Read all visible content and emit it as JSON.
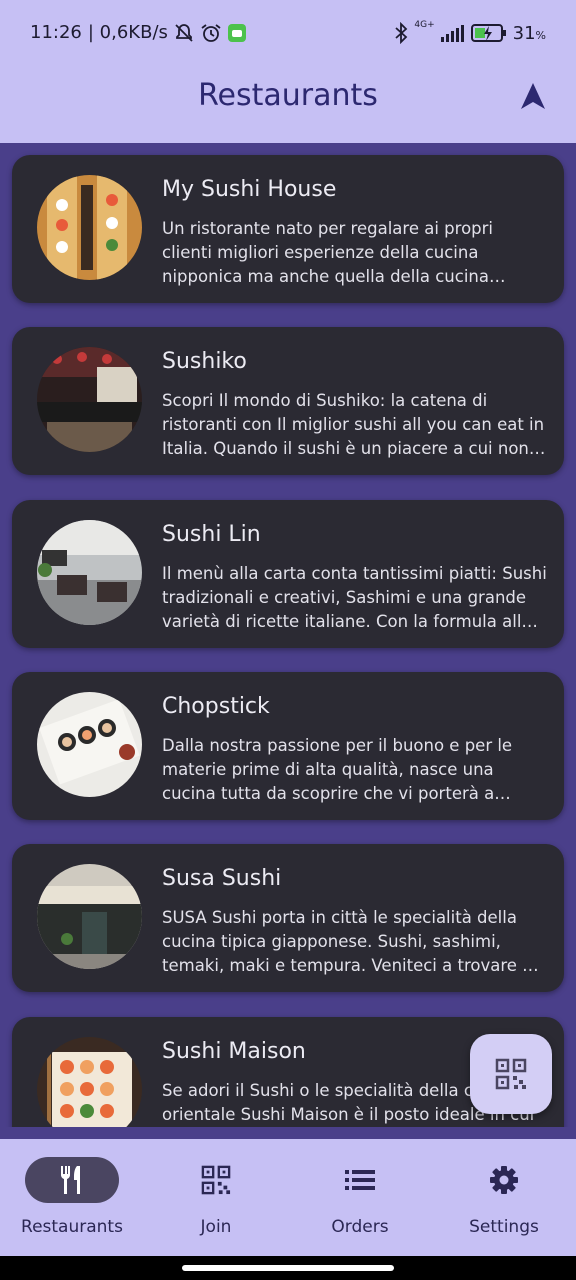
{
  "status_bar": {
    "time": "11:26",
    "network_speed": "| 0,6KB/s",
    "signal_label": "4G+",
    "battery_percent": "31",
    "battery_unit": "%"
  },
  "app_bar": {
    "title": "Restaurants",
    "navigation_icon": "navigation-arrow-icon"
  },
  "restaurants": [
    {
      "name": "My Sushi House",
      "description": "Un ristorante nato per regalare  ai propri clienti migliori esperienze della cucina nipponica ma anche quella della cucina cinese.",
      "image": "sushi-boats-photo"
    },
    {
      "name": "Sushiko",
      "description": "Scopri Il mondo di Sushiko: la catena di ristoranti con Il miglior sushi all you can eat in Italia. Quando il sushi è un piacere a cui non rinunciare.",
      "image": "restaurant-interior-photo"
    },
    {
      "name": "Sushi Lin",
      "description": "Il menù alla carta conta tantissimi piatti: Sushi tradizionali e creativi, Sashimi e una grande varietà di ricette italiane. Con la formula all you can eat.",
      "image": "dining-room-photo"
    },
    {
      "name": "Chopstick",
      "description": "Dalla nostra passione per il buono e per le materie prime di alta qualità, nasce una cucina tutta da scoprire che vi porterà a conoscere il Giappone.",
      "image": "sushi-rolls-photo"
    },
    {
      "name": "Susa Sushi",
      "description": "SUSA Sushi porta in città le specialità della cucina tipica giapponese. Sushi, sashimi, temaki, maki e tempura. Veniteci a trovare nel nostro locale.",
      "image": "storefront-photo"
    },
    {
      "name": "Sushi Maison",
      "description": "Se adori il Sushi o le specialità della cucina orientale Sushi Maison è il posto ideale in cui",
      "image": "sushi-tray-photo"
    }
  ],
  "fab": {
    "icon": "qr-code-icon"
  },
  "bottom_nav": [
    {
      "label": "Restaurants",
      "icon": "fork-knife-icon",
      "active": true
    },
    {
      "label": "Join",
      "icon": "qr-code-icon",
      "active": false
    },
    {
      "label": "Orders",
      "icon": "list-icon",
      "active": false
    },
    {
      "label": "Settings",
      "icon": "gear-icon",
      "active": false
    }
  ],
  "colors": {
    "bar_background": "#c6c0f4",
    "list_background": "#4a3f8a",
    "card_background": "#2b2a33",
    "active_indicator": "#4a4561",
    "title_color": "#2c2870"
  }
}
